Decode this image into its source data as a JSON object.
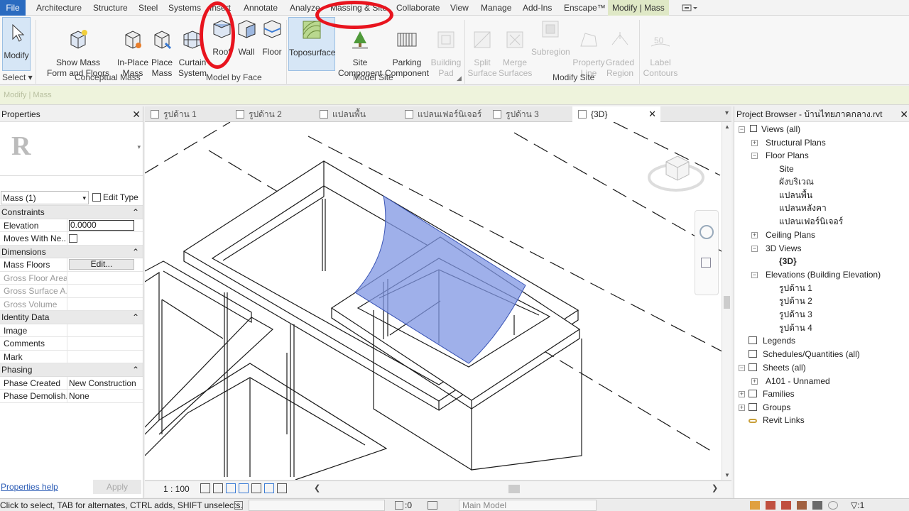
{
  "tabs": [
    "File",
    "Architecture",
    "Structure",
    "Steel",
    "Systems",
    "Insert",
    "Annotate",
    "Analyze",
    "Massing & Site",
    "Collaborate",
    "View",
    "Manage",
    "Add-Ins",
    "Enscape™",
    "Modify | Mass"
  ],
  "ribbon": {
    "buttons": {
      "modify": "Modify",
      "show_mass": "Show Mass\nForm and Floors",
      "in_place_mass": "In-Place\nMass",
      "place_mass": "Place\nMass",
      "curtain_system": "Curtain\nSystem",
      "roof": "Roof",
      "wall": "Wall",
      "floor": "Floor",
      "toposurface": "Toposurface",
      "site_component": "Site\nComponent",
      "parking_component": "Parking\nComponent",
      "building_pad": "Building\nPad",
      "split_surface": "Split\nSurface",
      "merge_surfaces": "Merge\nSurfaces",
      "subregion": "Subregion",
      "property_line": "Property\nLine",
      "graded_region": "Graded\nRegion",
      "label_contours": "Label\nContours"
    },
    "groups": {
      "select": "Select ▾",
      "conceptual_mass": "Conceptual Mass",
      "model_by_face": "Model by Face",
      "model_site": "Model Site",
      "modify_site": "Modify Site"
    }
  },
  "option_bar": "Modify | Mass",
  "properties": {
    "title": "Properties",
    "type_selector": "Mass (1)",
    "edit_type": "Edit Type",
    "sections": {
      "constraints": "Constraints",
      "dimensions": "Dimensions",
      "identity": "Identity Data",
      "phasing": "Phasing"
    },
    "rows": {
      "elevation_k": "Elevation",
      "elevation_v": "0.0000",
      "moves_k": "Moves With Ne...",
      "mass_floors_k": "Mass Floors",
      "mass_floors_v": "Edit...",
      "gfa_k": "Gross Floor Area",
      "gsa_k": "Gross Surface A...",
      "gv_k": "Gross Volume",
      "image_k": "Image",
      "comments_k": "Comments",
      "mark_k": "Mark",
      "phase_created_k": "Phase Created",
      "phase_created_v": "New Construction",
      "phase_demo_k": "Phase Demolish...",
      "phase_demo_v": "None"
    },
    "help_link": "Properties help",
    "apply": "Apply"
  },
  "view_tabs": [
    "รูปด้าน 1",
    "รูปด้าน 2",
    "แปลนพื้น",
    "แปลนเฟอร์นิเจอร์",
    "รูปด้าน 3",
    "{3D}"
  ],
  "view_scale": "1 : 100",
  "browser": {
    "title": "Project Browser - บ้านไทยภาคกลาง.rvt",
    "nodes": {
      "views_all": "Views (all)",
      "structural_plans": "Structural Plans",
      "floor_plans": "Floor Plans",
      "site": "Site",
      "fp1": "ผังบริเวณ",
      "fp2": "แปลนพื้น",
      "fp3": "แปลนหลังคา",
      "fp4": "แปลนเฟอร์นิเจอร์",
      "ceiling_plans": "Ceiling Plans",
      "views_3d": "3D Views",
      "view_3d": "{3D}",
      "elevations": "Elevations (Building Elevation)",
      "el1": "รูปด้าน 1",
      "el2": "รูปด้าน 2",
      "el3": "รูปด้าน 3",
      "el4": "รูปด้าน 4",
      "legends": "Legends",
      "schedules": "Schedules/Quantities (all)",
      "sheets": "Sheets (all)",
      "a101": "A101 - Unnamed",
      "families": "Families",
      "groups": "Groups",
      "revit_links": "Revit Links"
    }
  },
  "status": {
    "hint": "Click to select, TAB for alternates, CTRL adds, SHIFT unselects.",
    "zero": ":0",
    "model": "Main Model",
    "filter": ":1"
  },
  "colors": {
    "file_tab": "#2a6bc0",
    "context_tab": "#dfe8c6",
    "highlight": "#e8141e",
    "mass_face": "#7f95e3"
  }
}
